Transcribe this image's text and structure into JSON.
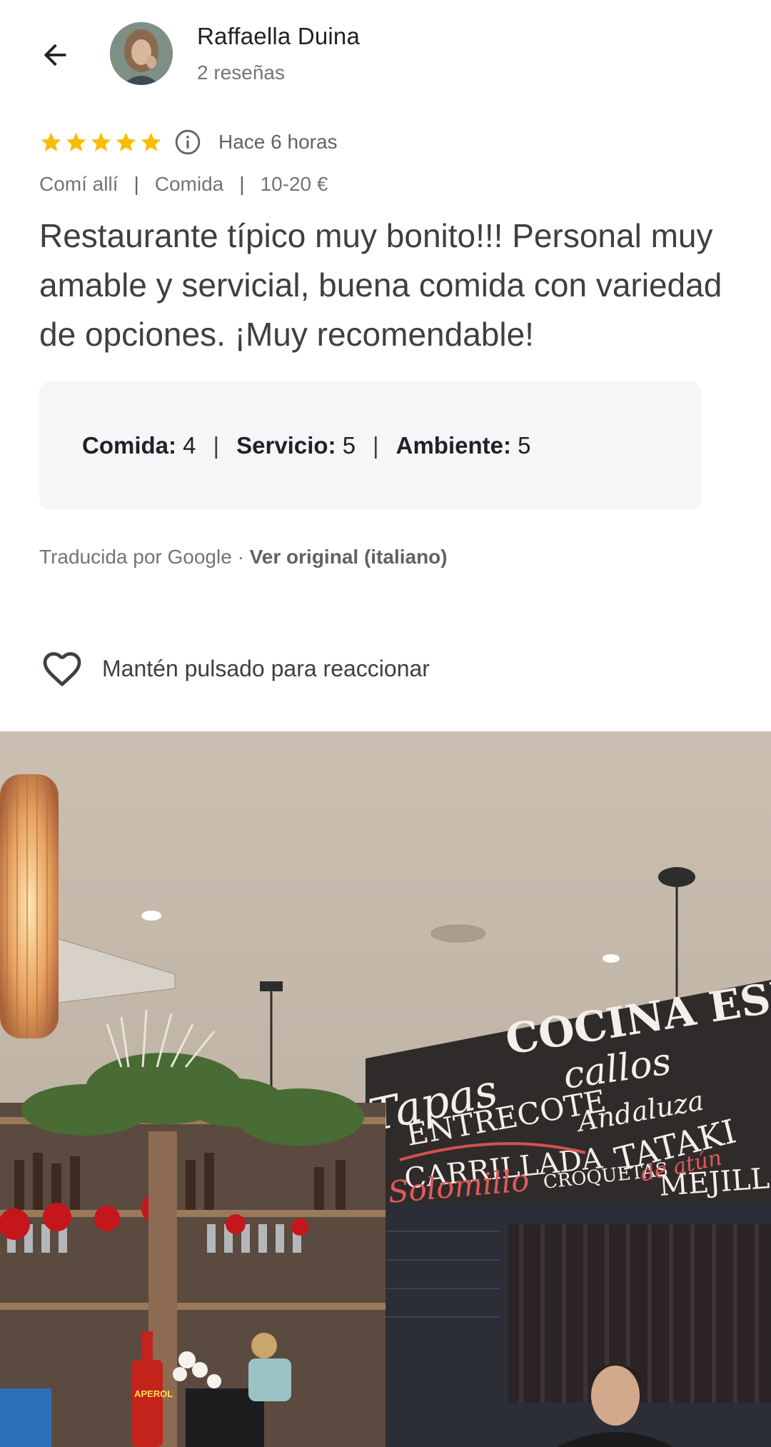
{
  "header": {
    "author_name": "Raffaella Duina",
    "author_meta": "2 reseñas"
  },
  "review": {
    "star_rating": 5,
    "time_ago": "Hace 6 horas",
    "visit": {
      "type": "Comí allí",
      "category": "Comida",
      "price": "10-20 €"
    },
    "text": "Restaurante típico muy bonito!!! Personal muy amable y servicial, buena comida con variedad de opciones. ¡Muy recomendable!",
    "sub_ratings": [
      {
        "label": "Comida:",
        "value": "4"
      },
      {
        "label": "Servicio:",
        "value": "5"
      },
      {
        "label": "Ambiente:",
        "value": "5"
      }
    ],
    "translated_prefix": "Traducida por Google · ",
    "see_original": "Ver original (italiano)",
    "react_label": "Mantén pulsado para reaccionar"
  },
  "photo": {
    "board_heading": "COCINA ESPA",
    "board_words": [
      "Tapas",
      "ENTRECOTE",
      "CARRILLADA",
      "CROQUETAS",
      "Solomillo",
      "callos",
      "Andaluza",
      "TATAKI",
      "de atún",
      "MEJILLONES"
    ],
    "bottle_label": "APEROL"
  },
  "colors": {
    "star": "#fbbc04",
    "text_primary": "#202124",
    "text_secondary": "#70757a",
    "ratings_bg": "#f5f6f8"
  }
}
